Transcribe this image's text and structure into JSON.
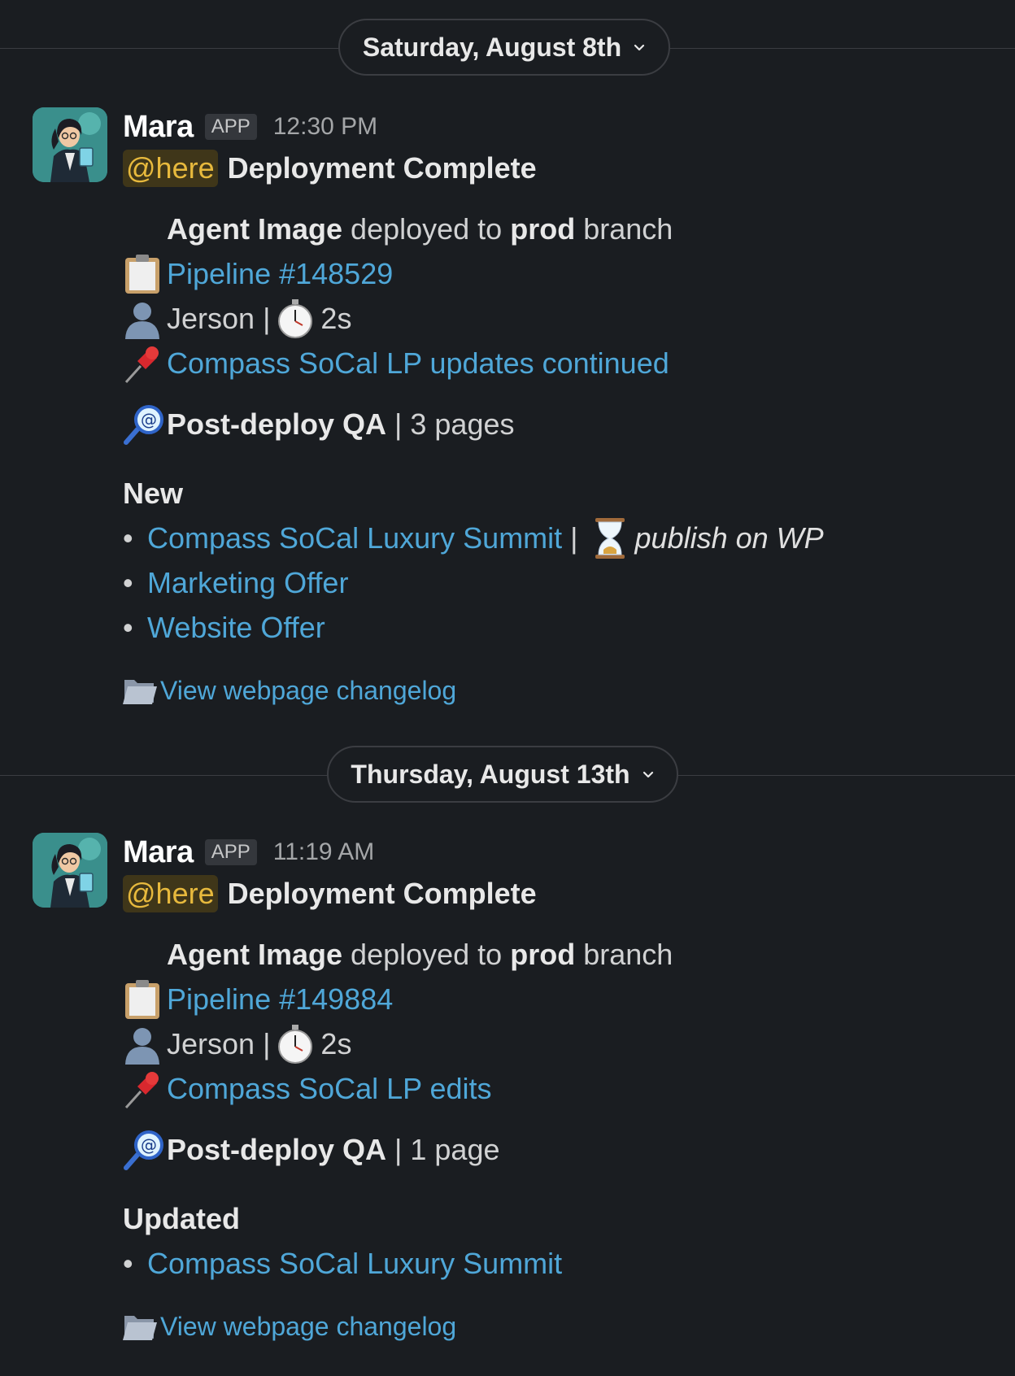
{
  "days": [
    {
      "date_label": "Saturday, August 8th",
      "message": {
        "author": "Mara",
        "badge": "APP",
        "time": "12:30 PM",
        "mention": "@here",
        "title": "Deployment Complete",
        "deploy_subject": "Agent Image",
        "deploy_mid": " deployed to ",
        "deploy_target": "prod",
        "deploy_tail": " branch",
        "pipeline": "Pipeline #148529",
        "user": "Jerson",
        "separator": "|",
        "duration": "2s",
        "task": "Compass SoCal LP updates continued",
        "qa_label": "Post-deploy QA",
        "qa_count": "| 3 pages",
        "section_heading": "New",
        "items": [
          {
            "label": "Compass SoCal Luxury Summit",
            "separator": "|",
            "note": "publish on WP"
          },
          {
            "label": "Marketing Offer"
          },
          {
            "label": "Website Offer"
          }
        ],
        "changelog": "View webpage changelog"
      }
    },
    {
      "date_label": "Thursday, August 13th",
      "message": {
        "author": "Mara",
        "badge": "APP",
        "time": "11:19 AM",
        "mention": "@here",
        "title": "Deployment Complete",
        "deploy_subject": "Agent Image",
        "deploy_mid": " deployed to ",
        "deploy_target": "prod",
        "deploy_tail": " branch",
        "pipeline": "Pipeline #149884",
        "user": "Jerson",
        "separator": "|",
        "duration": "2s",
        "task": "Compass SoCal LP edits",
        "qa_label": "Post-deploy QA",
        "qa_count": "| 1 page",
        "section_heading": "Updated",
        "items": [
          {
            "label": "Compass SoCal Luxury Summit"
          }
        ],
        "changelog": "View webpage changelog"
      }
    }
  ],
  "icons": {
    "pipeline": "clipboard-icon",
    "user": "bust-in-silhouette-icon",
    "duration": "stopwatch-icon",
    "task": "pushpin-icon",
    "qa": "magnifying-glass-icon",
    "pending": "hourglass-icon",
    "changelog": "folder-icon"
  },
  "colors": {
    "background": "#1a1d21",
    "link": "#4fa7d8",
    "mention_text": "#e7b93d",
    "mention_bg": "#3f3619"
  }
}
